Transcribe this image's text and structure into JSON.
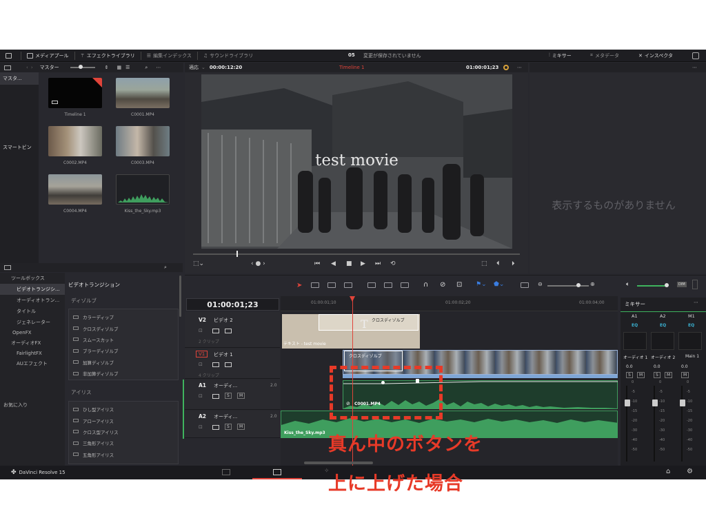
{
  "topbar": {
    "media_pool": "メディアプール",
    "effects_library": "エフェクトライブラリ",
    "edit_index": "編集インデックス",
    "sound_library": "サウンドライブラリ",
    "project_num": "05",
    "save_status": "変更が保存されていません",
    "mixer": "ミキサー",
    "metadata": "メタデータ",
    "inspector": "インスペクタ"
  },
  "media_bar": {
    "bin": "マスター"
  },
  "viewer_bar": {
    "fit": "適応",
    "timecode_left": "00:00:12:20",
    "timeline": "Timeline 1",
    "timecode_right": "01:00:01;23"
  },
  "sidebar": {
    "master": "マスタ...",
    "smart_bin": "スマートビン"
  },
  "clips": [
    {
      "name": "Timeline 1"
    },
    {
      "name": "C0001.MP4"
    },
    {
      "name": "C0002.MP4"
    },
    {
      "name": "C0003.MP4"
    },
    {
      "name": "C0004.MP4"
    },
    {
      "name": "Kiss_the_Sky.mp3"
    }
  ],
  "viewer": {
    "title_text": "test movie"
  },
  "inspector": {
    "empty": "表示するものがありません"
  },
  "effects_tree": {
    "toolbox": "ツールボックス",
    "video_transitions": "ビデオトランジシ...",
    "audio_transitions": "オーディオトラン...",
    "titles": "タイトル",
    "generators": "ジェネレーター",
    "openfx": "OpenFX",
    "audiofx": "オーディオFX",
    "fairlight": "FairlightFX",
    "au_effects": "AUエフェクト",
    "favorites": "お気に入り"
  },
  "transitions": {
    "header": "ビデオトランジション",
    "dissolve_title": "ディゾルブ",
    "dissolve_items": [
      "カラーディップ",
      "クロスディゾルブ",
      "スムースカット",
      "ブラーディゾルブ",
      "加算ディゾルブ",
      "非加算ディゾルブ"
    ],
    "iris_title": "アイリス",
    "iris_items": [
      "ひし型アイリス",
      "アローアイリス",
      "クロス型アイリス",
      "三角形アイリス",
      "五角形アイリス"
    ]
  },
  "timeline": {
    "timecode": "01:00:01;23",
    "ruler": [
      "01:00:01;10",
      "01:00:02;20",
      "01:00:04;00"
    ],
    "v2": {
      "id": "V2",
      "name": "ビデオ 2",
      "clips": "2 クリップ"
    },
    "v1": {
      "id": "V1",
      "name": "ビデオ 1",
      "clips": "4 クリップ"
    },
    "a1": {
      "id": "A1",
      "name": "オーディ...",
      "level": "2.0"
    },
    "a2": {
      "id": "A2",
      "name": "オーディ...",
      "level": "2.0"
    },
    "v2_transition": "クロスディゾルブ",
    "v2_text_clip": "テキスト - test movie",
    "v1_transition": "クロスディゾルブ",
    "a1_clip": "C0001.MP4",
    "a2_clip": "Kiss_the_Sky.mp3"
  },
  "mixer": {
    "title": "ミキサー",
    "channels": [
      "A1",
      "A2",
      "M1"
    ],
    "eq": "EQ",
    "labels": [
      "オーディオ 1",
      "オーディオ 2",
      "Main 1"
    ],
    "values": [
      "0.0",
      "0.0",
      "0.0"
    ],
    "scale": [
      "0",
      "-5",
      "-10",
      "-15",
      "-20",
      "-30",
      "-40",
      "-50"
    ]
  },
  "app": {
    "name": "DaVinci Resolve 15"
  },
  "annotation": {
    "line1": "真ん中のボタンを",
    "line2": "上に上げた場合"
  },
  "colors": {
    "accent_red": "#e73a28",
    "audio_green": "#3f9e5e",
    "playhead": "#e0443a"
  }
}
